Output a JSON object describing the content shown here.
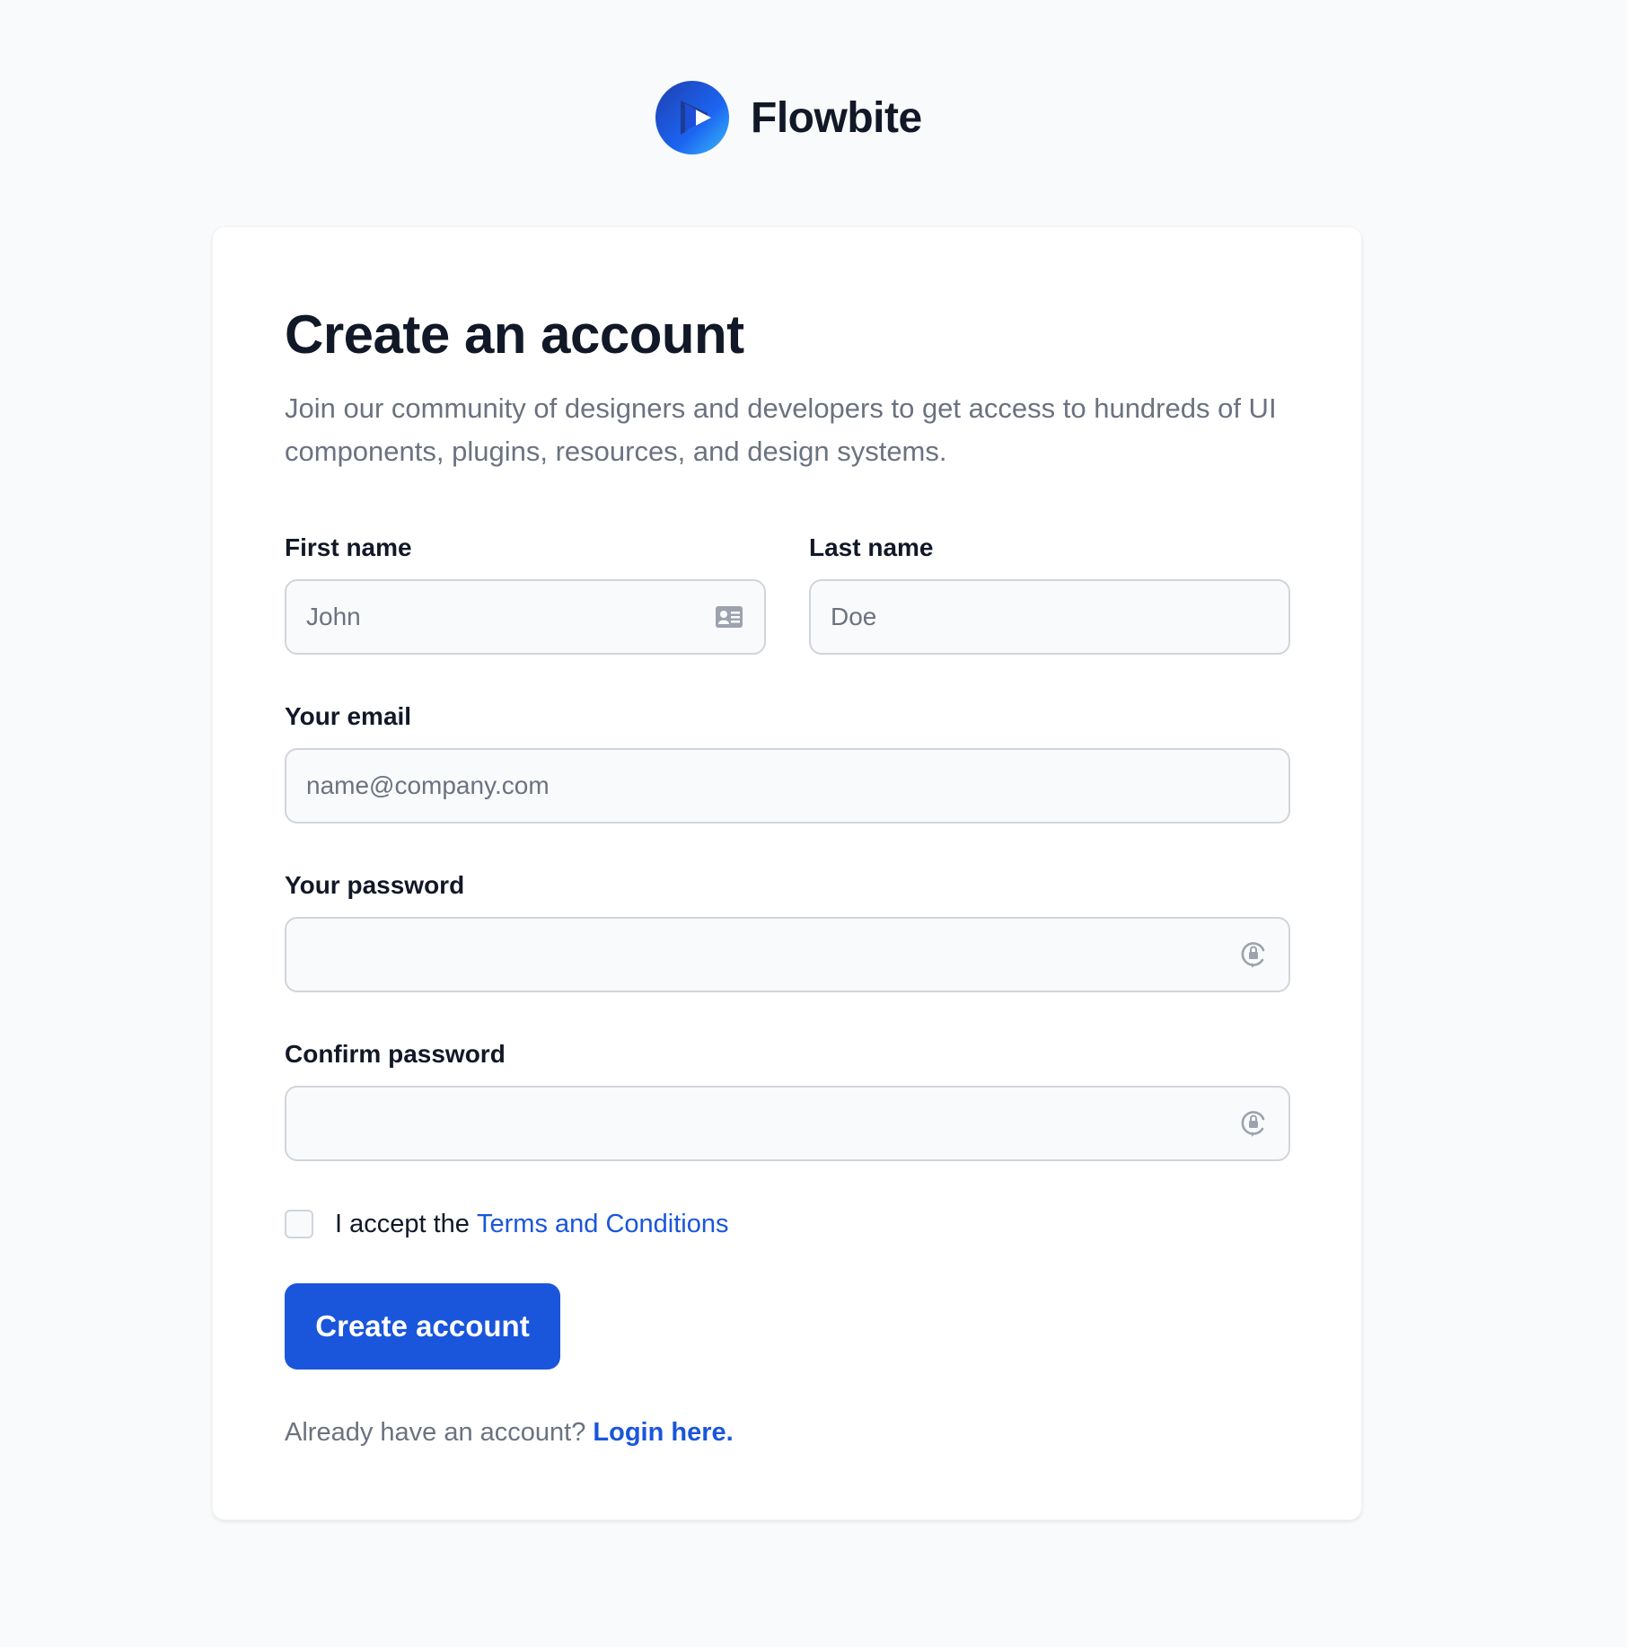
{
  "brand": {
    "name": "Flowbite",
    "logo_icon": "flowbite-play-logo",
    "logo_colors": [
      "#1a56db",
      "#1c64f2",
      "#3f83f8"
    ]
  },
  "form": {
    "title": "Create an account",
    "subtitle": "Join our community of designers and developers to get access to hundreds of UI components, plugins, resources, and design systems.",
    "first_name": {
      "label": "First name",
      "placeholder": "John",
      "icon": "contact-card-icon"
    },
    "last_name": {
      "label": "Last name",
      "placeholder": "Doe"
    },
    "email": {
      "label": "Your email",
      "placeholder": "name@company.com"
    },
    "password": {
      "label": "Your password",
      "value": "",
      "icon": "password-lock-icon"
    },
    "confirm_password": {
      "label": "Confirm password",
      "value": "",
      "icon": "password-lock-icon"
    },
    "terms": {
      "checked": false,
      "prefix": "I accept the ",
      "link_text": "Terms and Conditions"
    },
    "submit_label": "Create account",
    "login": {
      "prefix": "Already have an account? ",
      "link_text": "Login here."
    }
  },
  "colors": {
    "primary": "#1a56db",
    "background": "#f9fafb",
    "card": "#ffffff",
    "muted_text": "#6b7280",
    "input_border": "#d1d5db"
  }
}
